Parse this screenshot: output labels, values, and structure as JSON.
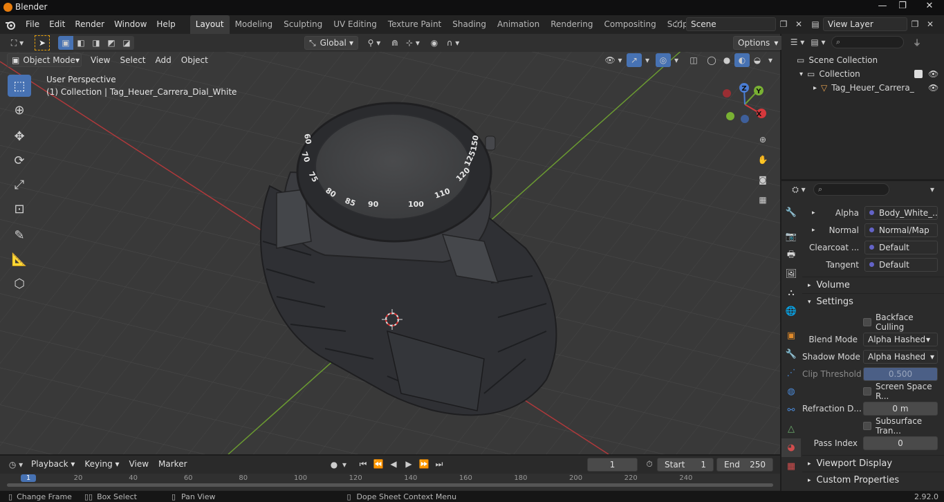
{
  "app": {
    "title": "Blender",
    "version": "2.92.0"
  },
  "menu": [
    "File",
    "Edit",
    "Render",
    "Window",
    "Help"
  ],
  "workspaces": [
    "Layout",
    "Modeling",
    "Sculpting",
    "UV Editing",
    "Texture Paint",
    "Shading",
    "Animation",
    "Rendering",
    "Compositing",
    "Scripting"
  ],
  "add_workspace": "+",
  "scene": {
    "name": "Scene",
    "view_layer": "View Layer"
  },
  "viewport_header": {
    "orientation": "Global",
    "options": "Options",
    "mode": "Object Mode",
    "menus": [
      "View",
      "Select",
      "Add",
      "Object"
    ]
  },
  "viewport": {
    "perspective": "User Perspective",
    "collection_info": "(1) Collection | Tag_Heuer_Carrera_Dial_White",
    "gizmo": {
      "x": "X",
      "y": "Y",
      "z": "Z"
    },
    "bezel_numbers": [
      "70",
      "75",
      "80",
      "85",
      "90",
      "100",
      "110",
      "120",
      "125",
      "150",
      "60"
    ]
  },
  "outliner": {
    "scene_collection": "Scene Collection",
    "collection": "Collection",
    "object": "Tag_Heuer_Carrera_D"
  },
  "properties": {
    "sockets": [
      {
        "label": "Alpha",
        "value": "Body_White_...",
        "expand": "▸"
      },
      {
        "label": "Normal",
        "value": "Normal/Map",
        "expand": "▸"
      },
      {
        "label": "Clearcoat ...",
        "value": "Default",
        "expand": ""
      },
      {
        "label": "Tangent",
        "value": "Default",
        "expand": ""
      }
    ],
    "volume": "Volume",
    "settings": "Settings",
    "backface_culling": "Backface Culling",
    "blend_mode": {
      "label": "Blend Mode",
      "value": "Alpha Hashed"
    },
    "shadow_mode": {
      "label": "Shadow Mode",
      "value": "Alpha Hashed"
    },
    "clip_threshold": {
      "label": "Clip Threshold",
      "value": "0.500"
    },
    "screen_space": "Screen Space R...",
    "refraction": {
      "label": "Refraction D...",
      "value": "0 m"
    },
    "subsurface": "Subsurface Tran...",
    "pass_index": {
      "label": "Pass Index",
      "value": "0"
    },
    "viewport_display": "Viewport Display",
    "custom_properties": "Custom Properties"
  },
  "timeline": {
    "menus": [
      "Playback",
      "Keying",
      "View",
      "Marker"
    ],
    "current_frame": "1",
    "start_label": "Start",
    "start": "1",
    "end_label": "End",
    "end": "250",
    "ruler": [
      "1",
      "20",
      "40",
      "60",
      "80",
      "100",
      "120",
      "140",
      "160",
      "180",
      "200",
      "220",
      "240"
    ]
  },
  "status": {
    "change_frame": "Change Frame",
    "box_select": "Box Select",
    "pan_view": "Pan View",
    "context_menu": "Dope Sheet Context Menu"
  },
  "colors": {
    "accent": "#4772b3",
    "orange": "#e87d0d",
    "x_axis": "#d6383c",
    "y_axis": "#6fa131",
    "z_axis": "#4a7dd4"
  }
}
